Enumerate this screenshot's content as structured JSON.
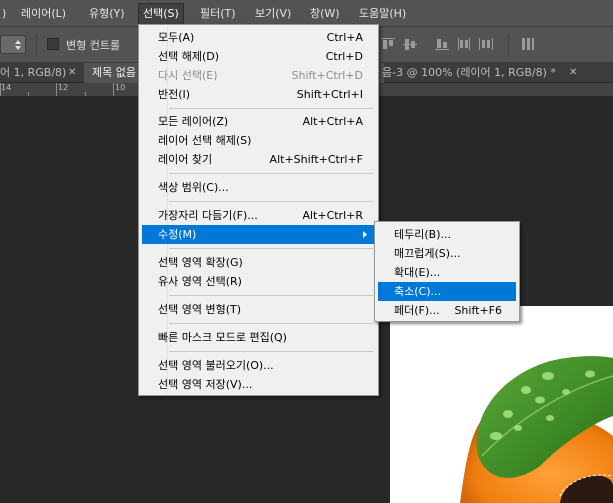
{
  "menubar": {
    "items": [
      {
        "label": ")"
      },
      {
        "label": "레이어(L)"
      },
      {
        "label": "유형(Y)"
      },
      {
        "label": "선택(S)"
      },
      {
        "label": "필터(T)"
      },
      {
        "label": "보기(V)"
      },
      {
        "label": "창(W)"
      },
      {
        "label": "도움말(H)"
      }
    ]
  },
  "options_bar": {
    "transform_controls_label": "변형 컨트롤",
    "transform_checkbox_checked": false
  },
  "tabs": [
    {
      "label": "어 1, RGB/8)"
    },
    {
      "label": "제목 없음"
    },
    {
      "label": "음-3 @ 100% (레이어 1, RGB/8) *"
    }
  ],
  "ruler": {
    "numbers": [
      "14",
      "12",
      "10"
    ]
  },
  "select_menu": {
    "items": [
      {
        "label": "모두(A)",
        "shortcut": "Ctrl+A",
        "disabled": false
      },
      {
        "label": "선택 해제(D)",
        "shortcut": "Ctrl+D",
        "disabled": false
      },
      {
        "label": "다시 선택(E)",
        "shortcut": "Shift+Ctrl+D",
        "disabled": true
      },
      {
        "label": "반전(I)",
        "shortcut": "Shift+Ctrl+I",
        "disabled": false
      },
      {
        "label": "모든 레이어(Z)",
        "shortcut": "Alt+Ctrl+A",
        "disabled": false
      },
      {
        "label": "레이어 선택 해제(S)",
        "shortcut": "",
        "disabled": false
      },
      {
        "label": "레이어 찾기",
        "shortcut": "Alt+Shift+Ctrl+F",
        "disabled": false
      },
      {
        "label": "색상 범위(C)...",
        "shortcut": "",
        "disabled": false
      },
      {
        "label": "가장자리 다듬기(F)...",
        "shortcut": "Alt+Ctrl+R",
        "disabled": false
      },
      {
        "label": "수정(M)",
        "shortcut": "",
        "disabled": false
      },
      {
        "label": "선택 영역 확장(G)",
        "shortcut": "",
        "disabled": false
      },
      {
        "label": "유사 영역 선택(R)",
        "shortcut": "",
        "disabled": false
      },
      {
        "label": "선택 영역 변형(T)",
        "shortcut": "",
        "disabled": false
      },
      {
        "label": "빠른 마스크 모드로 편집(Q)",
        "shortcut": "",
        "disabled": false
      },
      {
        "label": "선택 영역 불러오기(O)...",
        "shortcut": "",
        "disabled": false
      },
      {
        "label": "선택 영역 저장(V)...",
        "shortcut": "",
        "disabled": false
      }
    ]
  },
  "modify_submenu": {
    "items": [
      {
        "label": "테두리(B)...",
        "shortcut": ""
      },
      {
        "label": "매끄럽게(S)...",
        "shortcut": ""
      },
      {
        "label": "확대(E)...",
        "shortcut": ""
      },
      {
        "label": "축소(C)...",
        "shortcut": ""
      },
      {
        "label": "페더(F)...",
        "shortcut": "Shift+F6"
      }
    ]
  },
  "colors": {
    "highlight": "#0078d7",
    "menubar_bg": "#535353",
    "workspace_bg": "#282828",
    "menu_bg": "#f0f0f0"
  }
}
